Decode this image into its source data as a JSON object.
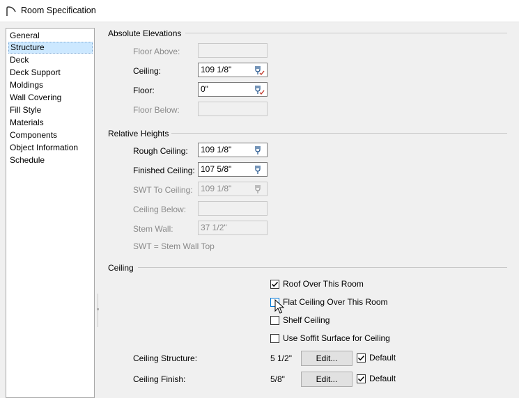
{
  "window": {
    "title": "Room Specification"
  },
  "sidebar": {
    "items": [
      {
        "label": "General",
        "selected": false
      },
      {
        "label": "Structure",
        "selected": true
      },
      {
        "label": "Deck",
        "selected": false
      },
      {
        "label": "Deck Support",
        "selected": false
      },
      {
        "label": "Moldings",
        "selected": false
      },
      {
        "label": "Wall Covering",
        "selected": false
      },
      {
        "label": "Fill Style",
        "selected": false
      },
      {
        "label": "Materials",
        "selected": false
      },
      {
        "label": "Components",
        "selected": false
      },
      {
        "label": "Object Information",
        "selected": false
      },
      {
        "label": "Schedule",
        "selected": false
      }
    ]
  },
  "absolute": {
    "title": "Absolute Elevations",
    "floor_above_label": "Floor Above:",
    "floor_above_value": "",
    "ceiling_label": "Ceiling:",
    "ceiling_value": "109 1/8\"",
    "floor_label": "Floor:",
    "floor_value": "0\"",
    "floor_below_label": "Floor Below:",
    "floor_below_value": ""
  },
  "relative": {
    "title": "Relative Heights",
    "rough_ceiling_label": "Rough Ceiling:",
    "rough_ceiling_value": "109 1/8\"",
    "finished_ceiling_label": "Finished Ceiling:",
    "finished_ceiling_value": "107 5/8\"",
    "swt_to_ceiling_label": "SWT To Ceiling:",
    "swt_to_ceiling_value": "109 1/8\"",
    "ceiling_below_label": "Ceiling Below:",
    "ceiling_below_value": "",
    "stem_wall_label": "Stem Wall:",
    "stem_wall_value": "37 1/2\"",
    "swt_note": "SWT = Stem Wall Top"
  },
  "ceiling": {
    "title": "Ceiling",
    "roof_over_label": "Roof Over This Room",
    "roof_over_checked": true,
    "flat_ceiling_label": "Flat Ceiling Over This Room",
    "flat_ceiling_checked": false,
    "shelf_ceiling_label": "Shelf Ceiling",
    "shelf_ceiling_checked": false,
    "soffit_label": "Use Soffit Surface for Ceiling",
    "soffit_checked": false,
    "structure_label": "Ceiling Structure:",
    "structure_value": "5 1/2\"",
    "structure_edit": "Edit...",
    "structure_default_label": "Default",
    "structure_default_checked": true,
    "finish_label": "Ceiling Finish:",
    "finish_value": "5/8\"",
    "finish_edit": "Edit...",
    "finish_default_label": "Default",
    "finish_default_checked": true
  },
  "colors": {
    "selection": "#cce8ff",
    "disabled_text": "#8a8a8a",
    "accent": "#0078d7"
  }
}
